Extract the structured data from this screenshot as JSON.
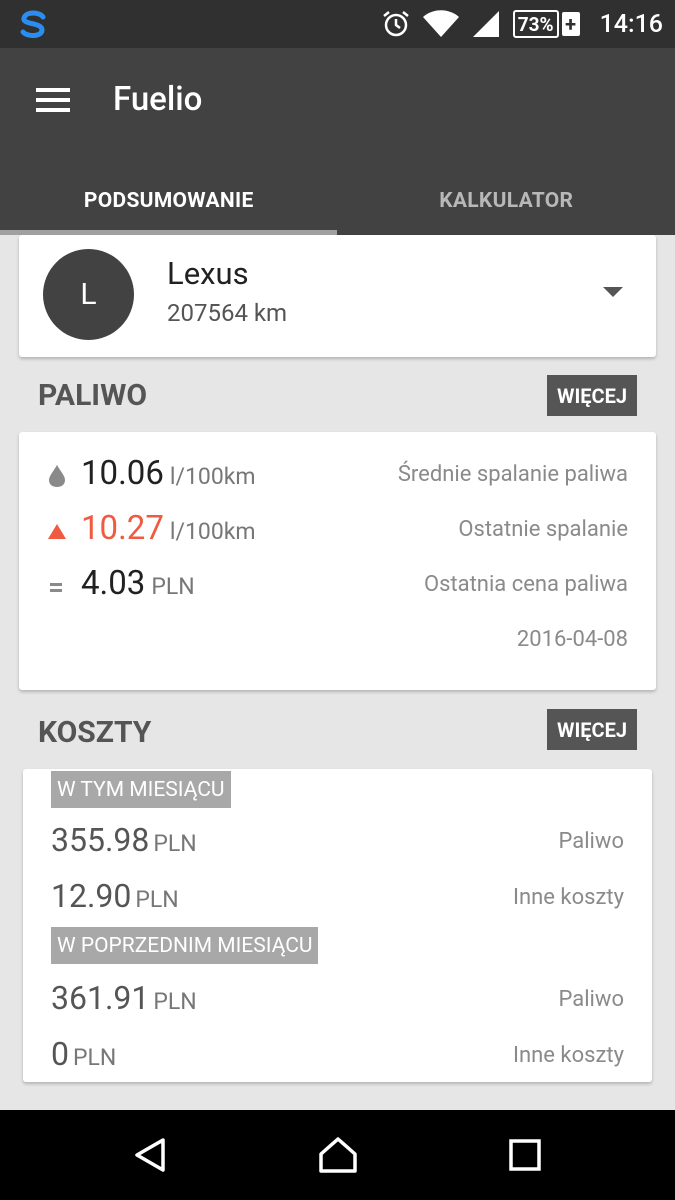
{
  "status_bar": {
    "battery": "73%",
    "battery_plus": "+",
    "time": "14:16"
  },
  "app_bar": {
    "title": "Fuelio",
    "tabs": [
      {
        "label": "PODSUMOWANIE",
        "active": true
      },
      {
        "label": "KALKULATOR",
        "active": false
      }
    ]
  },
  "vehicle": {
    "avatar_letter": "L",
    "name": "Lexus",
    "odometer": "207564 km"
  },
  "fuel": {
    "header": "PALIWO",
    "more_label": "WIĘCEJ",
    "rows": [
      {
        "icon": "drop-icon",
        "value": "10.06",
        "unit": "l/100km",
        "label": "Średnie spalanie paliwa"
      },
      {
        "icon": "up-arrow-icon",
        "value": "10.27",
        "unit": "l/100km",
        "label": "Ostatnie spalanie"
      },
      {
        "icon": "equals-icon",
        "value": "4.03",
        "unit": "PLN",
        "label": "Ostatnia cena paliwa"
      }
    ],
    "date": "2016-04-08"
  },
  "costs": {
    "header": "KOSZTY",
    "more_label": "WIĘCEJ",
    "this_month": {
      "label": "W TYM MIESIĄCU",
      "rows": [
        {
          "value": "355.98",
          "unit": "PLN",
          "label": "Paliwo"
        },
        {
          "value": "12.90",
          "unit": "PLN",
          "label": "Inne koszty"
        }
      ]
    },
    "prev_month": {
      "label": "W POPRZEDNIM MIESIĄCU",
      "rows": [
        {
          "value": "361.91",
          "unit": "PLN",
          "label": "Paliwo"
        },
        {
          "value": "0",
          "unit": "PLN",
          "label": "Inne koszty"
        }
      ]
    }
  },
  "colors": {
    "status_bar": "#303030",
    "app_bar": "#424242",
    "accent_red": "#f05a40",
    "background": "#e6e6e6"
  }
}
